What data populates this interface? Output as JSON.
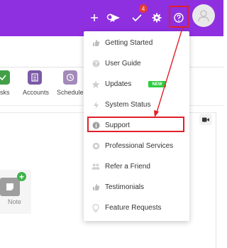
{
  "header": {
    "notification_count": "4",
    "icons": [
      "send-icon",
      "plus-icon",
      "search-icon",
      "check-icon",
      "gear-icon",
      "help-icon",
      "avatar-icon"
    ]
  },
  "app_bar": {
    "items": [
      {
        "label": "sks",
        "icon": "check-icon",
        "color": "#43a047"
      },
      {
        "label": "Accounts",
        "icon": "building-icon",
        "color": "#7b5aa6"
      },
      {
        "label": "Schedule",
        "icon": "clock-icon",
        "color": "#a38ab8"
      }
    ]
  },
  "content": {
    "note_label": "Note"
  },
  "help_menu": {
    "new_badge": "NEW",
    "items": [
      {
        "label": "Getting Started",
        "icon": "thumbs-up-icon"
      },
      {
        "label": "User Guide",
        "icon": "question-icon"
      },
      {
        "label": "Updates",
        "icon": "star-icon"
      },
      {
        "label": "System Status",
        "icon": "bolt-icon"
      },
      {
        "label": "Support",
        "icon": "info-icon"
      },
      {
        "label": "Professional Services",
        "icon": "gear-badge-icon"
      },
      {
        "label": "Refer a Friend",
        "icon": "users-icon"
      },
      {
        "label": "Testimonials",
        "icon": "thumbs-up-icon"
      },
      {
        "label": "Feature Requests",
        "icon": "lightbulb-icon"
      }
    ]
  },
  "colors": {
    "header": "#8e2fe0",
    "highlight": "#e0202a",
    "badge": "#e53935",
    "new_badge": "#2ecc40"
  }
}
